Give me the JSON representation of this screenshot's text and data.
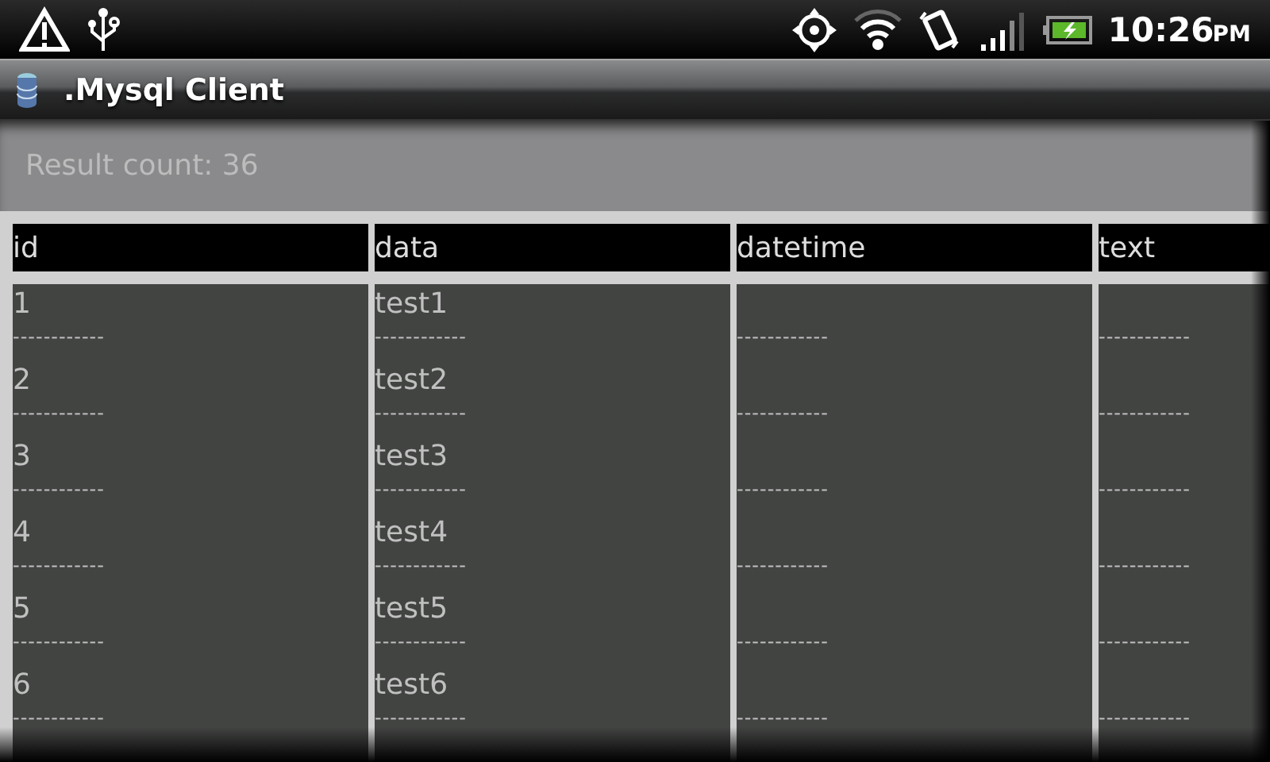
{
  "status_bar": {
    "time": "10:26",
    "meridiem": "PM"
  },
  "title_bar": {
    "title": ".Mysql Client"
  },
  "result": {
    "label": "Result count: 36"
  },
  "table": {
    "columns": [
      "id",
      "data",
      "datetime",
      "text"
    ],
    "rows": [
      {
        "cells": [
          {
            "value": "1",
            "rule": "------------"
          },
          {
            "value": "test1",
            "rule": "------------"
          },
          {
            "rule": "------------"
          },
          {
            "rule": "------------"
          }
        ]
      },
      {
        "cells": [
          {
            "value": "2",
            "rule": "------------"
          },
          {
            "value": "test2",
            "rule": "------------"
          },
          {
            "rule": "------------"
          },
          {
            "rule": "------------"
          }
        ]
      },
      {
        "cells": [
          {
            "value": "3",
            "rule": "------------"
          },
          {
            "value": "test3",
            "rule": "------------"
          },
          {
            "rule": "------------"
          },
          {
            "rule": "------------"
          }
        ]
      },
      {
        "cells": [
          {
            "value": "4",
            "rule": "------------"
          },
          {
            "value": "test4",
            "rule": "------------"
          },
          {
            "rule": "------------"
          },
          {
            "rule": "------------"
          }
        ]
      },
      {
        "cells": [
          {
            "value": "5",
            "rule": "------------"
          },
          {
            "value": "test5",
            "rule": "------------"
          },
          {
            "rule": "------------"
          },
          {
            "rule": "------------"
          }
        ]
      },
      {
        "cells": [
          {
            "value": "6",
            "rule": "------------"
          },
          {
            "value": "test6",
            "rule": "------------"
          },
          {
            "rule": "------------"
          },
          {
            "rule": "------------"
          }
        ]
      }
    ]
  }
}
